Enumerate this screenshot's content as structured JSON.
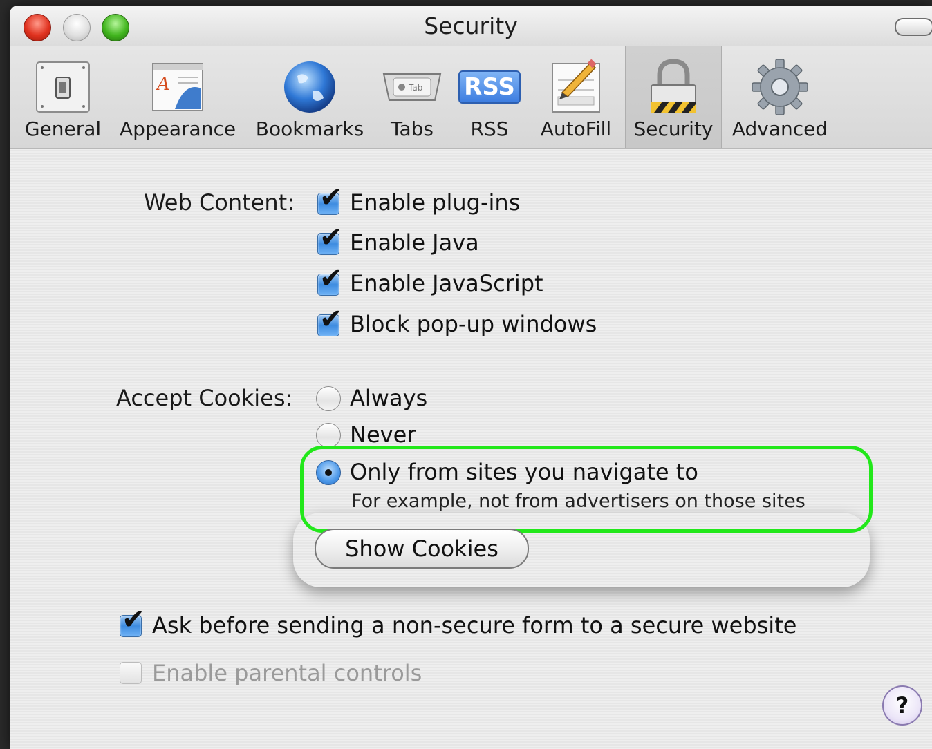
{
  "window": {
    "title": "Security"
  },
  "toolbar": {
    "items": [
      {
        "label": "General",
        "icon": "general-switch-icon"
      },
      {
        "label": "Appearance",
        "icon": "appearance-icon"
      },
      {
        "label": "Bookmarks",
        "icon": "globe-icon"
      },
      {
        "label": "Tabs",
        "icon": "tabs-icon"
      },
      {
        "label": "RSS",
        "icon": "rss-icon",
        "badge": "RSS"
      },
      {
        "label": "AutoFill",
        "icon": "autofill-pencil-icon"
      },
      {
        "label": "Security",
        "icon": "lock-icon",
        "selected": true
      },
      {
        "label": "Advanced",
        "icon": "gear-icon"
      }
    ],
    "tabs_icon_text": "Tab"
  },
  "web_content": {
    "label": "Web Content:",
    "options": [
      {
        "label": "Enable plug-ins",
        "checked": true
      },
      {
        "label": "Enable Java",
        "checked": true
      },
      {
        "label": "Enable JavaScript",
        "checked": true
      },
      {
        "label": "Block pop-up windows",
        "checked": true
      }
    ]
  },
  "cookies": {
    "label": "Accept Cookies:",
    "options": [
      {
        "label": "Always",
        "selected": false
      },
      {
        "label": "Never",
        "selected": false
      },
      {
        "label": "Only from sites you navigate to",
        "selected": true
      }
    ],
    "hint": "For example, not from advertisers on those sites",
    "show_button": "Show Cookies"
  },
  "bottom_options": [
    {
      "label": "Ask before sending a non-secure form to a secure website",
      "checked": true,
      "enabled": true
    },
    {
      "label": "Enable parental controls",
      "checked": false,
      "enabled": false
    }
  ],
  "help": {
    "label": "?"
  },
  "colors": {
    "highlight": "#22e81a",
    "accent": "#3e8ce0"
  }
}
